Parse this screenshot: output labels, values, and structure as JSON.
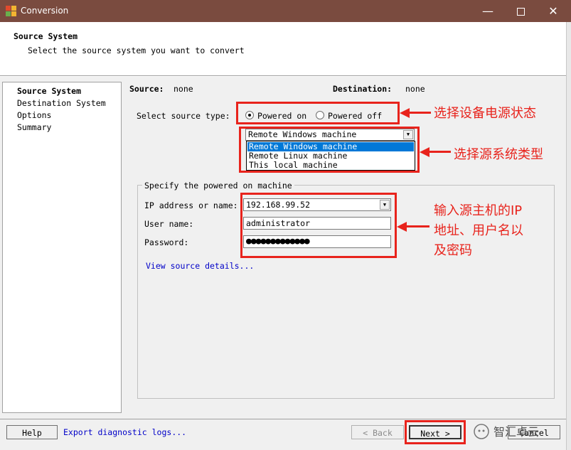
{
  "window": {
    "title": "Conversion",
    "minimize_icon": "minimize-icon",
    "maximize_icon": "maximize-icon",
    "close_icon": "close-icon"
  },
  "header": {
    "title": "Source System",
    "subtitle": "Select the source system you want to convert"
  },
  "nav": {
    "items": [
      {
        "label": "Source System",
        "active": true
      },
      {
        "label": "Destination System",
        "active": false
      },
      {
        "label": "Options",
        "active": false
      },
      {
        "label": "Summary",
        "active": false
      }
    ]
  },
  "summary": {
    "source_label": "Source:",
    "source_value": "none",
    "destination_label": "Destination:",
    "destination_value": "none"
  },
  "source_type": {
    "label": "Select source type:",
    "powered_on": "Powered on",
    "powered_off": "Powered off",
    "selected": "powered_on"
  },
  "machine_type": {
    "value": "Remote Windows machine",
    "options": [
      "Remote Windows machine",
      "Remote Linux machine",
      "This local machine"
    ],
    "highlighted_index": 0
  },
  "machine": {
    "group_title": "Specify the powered on machine",
    "ip_label": "IP address or name:",
    "ip_value": "192.168.99.52",
    "user_label": "User name:",
    "user_value": "administrator",
    "password_label": "Password:",
    "password_value": "●●●●●●●●●●●●●",
    "details_link": "View source details..."
  },
  "footer": {
    "help": "Help",
    "export_link": "Export diagnostic logs...",
    "back": "< Back",
    "next": "Next >",
    "cancel": "Cancel"
  },
  "annotations": {
    "power_state": "选择设备电源状态",
    "source_type": "选择源系统类型",
    "host_line1": "输入源主机的IP",
    "host_line2": "地址、用户名以",
    "host_line3": "及密码",
    "color": "#e8231c"
  },
  "watermark": {
    "text": "智汇卓云"
  },
  "colors": {
    "titlebar": "#7a4b3f",
    "selection": "#0078d7",
    "link": "#0000c8"
  }
}
